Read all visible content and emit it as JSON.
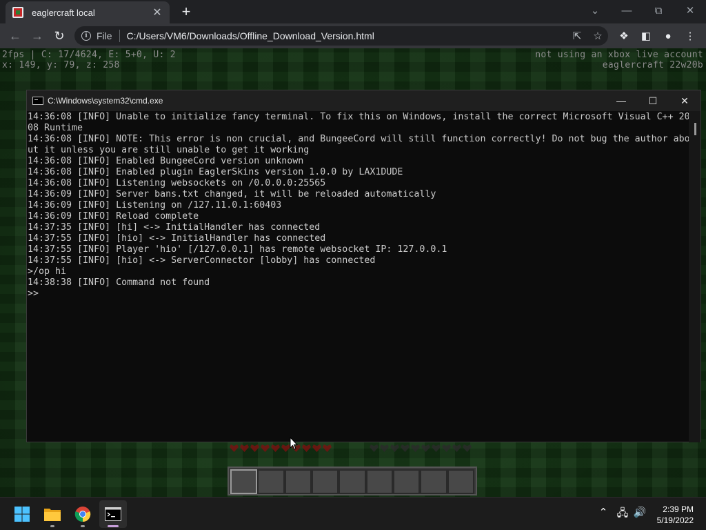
{
  "browser": {
    "tab_title": "eaglercraft local",
    "tab_close": "✕",
    "new_tab": "+",
    "scheme_label": "File",
    "url": "C:/Users/VM6/Downloads/Offline_Download_Version.html"
  },
  "game": {
    "debug_left": [
      "2fps | C: 17/4624, E: 5+0, U: 2",
      "x: 149, y: 79, z: 258"
    ],
    "debug_right": [
      "not using an xbox live account",
      "eaglercraft 22w20b"
    ],
    "hearts": 10,
    "armor": 10,
    "hotbar_slots": 9,
    "hotbar_selected": 0
  },
  "cmd": {
    "title": "C:\\Windows\\system32\\cmd.exe",
    "lines": [
      "14:36:08 [INFO] Unable to initialize fancy terminal. To fix this on Windows, install the correct Microsoft Visual C++ 20",
      "08 Runtime",
      "14:36:08 [INFO] NOTE: This error is non crucial, and BungeeCord will still function correctly! Do not bug the author abo",
      "ut it unless you are still unable to get it working",
      "14:36:08 [INFO] Enabled BungeeCord version unknown",
      "14:36:08 [INFO] Enabled plugin EaglerSkins version 1.0.0 by LAX1DUDE",
      "14:36:08 [INFO] Listening websockets on /0.0.0.0:25565",
      "14:36:09 [INFO] Server bans.txt changed, it will be reloaded automatically",
      "14:36:09 [INFO] Listening on /127.11.0.1:60403",
      "14:36:09 [INFO] Reload complete",
      "14:37:35 [INFO] [hi] <-> InitialHandler has connected",
      "14:37:55 [INFO] [hio] <-> InitialHandler has connected",
      "14:37:55 [INFO] Player 'hio' [/127.0.0.1] has remote websocket IP: 127.0.0.1",
      "14:37:55 [INFO] [hio] <-> ServerConnector [lobby] has connected",
      ">/op hi",
      "14:38:38 [INFO] Command not found",
      ">>"
    ]
  },
  "taskbar": {
    "time": "2:39 PM",
    "date": "5/19/2022"
  }
}
